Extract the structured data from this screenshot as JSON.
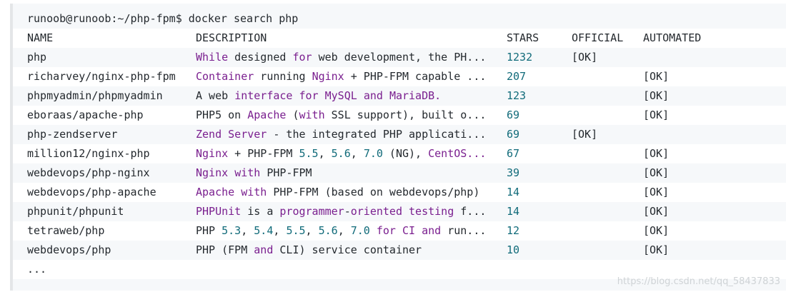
{
  "command": "runoob@runoob:~/php-fpm$ docker search php",
  "headers": {
    "name": "NAME",
    "description": "DESCRIPTION",
    "stars": "STARS",
    "official": "OFFICIAL",
    "automated": "AUTOMATED"
  },
  "rows": [
    {
      "name": "php",
      "description": "While designed for web development, the PH...",
      "stars": "1232",
      "official": "[OK]",
      "automated": ""
    },
    {
      "name": "richarvey/nginx-php-fpm",
      "description": "Container running Nginx + PHP-FPM capable ...",
      "stars": "207",
      "official": "",
      "automated": "[OK]"
    },
    {
      "name": "phpmyadmin/phpmyadmin",
      "description": "A web interface for MySQL and MariaDB.",
      "stars": "123",
      "official": "",
      "automated": "[OK]"
    },
    {
      "name": "eboraas/apache-php",
      "description": "PHP5 on Apache (with SSL support), built o...",
      "stars": "69",
      "official": "",
      "automated": "[OK]"
    },
    {
      "name": "php-zendserver",
      "description": "Zend Server - the integrated PHP applicati...",
      "stars": "69",
      "official": "[OK]",
      "automated": ""
    },
    {
      "name": "million12/nginx-php",
      "description": "Nginx + PHP-FPM 5.5, 5.6, 7.0 (NG), CentOS...",
      "stars": "67",
      "official": "",
      "automated": "[OK]"
    },
    {
      "name": "webdevops/php-nginx",
      "description": "Nginx with PHP-FPM",
      "stars": "39",
      "official": "",
      "automated": "[OK]"
    },
    {
      "name": "webdevops/php-apache",
      "description": "Apache with PHP-FPM (based on webdevops/php)",
      "stars": "14",
      "official": "",
      "automated": "[OK]"
    },
    {
      "name": "phpunit/phpunit",
      "description": "PHPUnit is a programmer-oriented testing f...",
      "stars": "14",
      "official": "",
      "automated": "[OK]"
    },
    {
      "name": "tetraweb/php",
      "description": "PHP 5.3, 5.4, 5.5, 5.6, 7.0 for CI and run...",
      "stars": "12",
      "official": "",
      "automated": "[OK]"
    },
    {
      "name": "webdevops/php",
      "description": "PHP (FPM and CLI) service container",
      "stars": "10",
      "official": "",
      "automated": "[OK]"
    }
  ],
  "ellipsis": "...",
  "watermark": "https://blog.csdn.net/qq_58437833"
}
